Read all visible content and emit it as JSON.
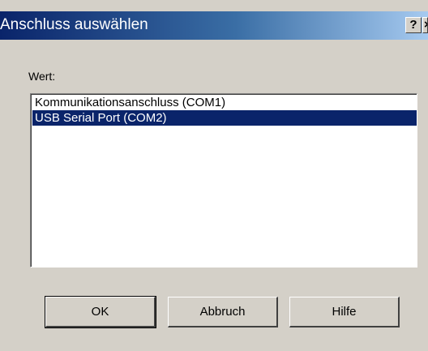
{
  "window": {
    "title": "Anschluss auswählen",
    "help_glyph": "?",
    "close_glyph": "×"
  },
  "content": {
    "value_label": "Wert:",
    "list_items": [
      {
        "label": "Kommunikationsanschluss (COM1)",
        "selected": false
      },
      {
        "label": "USB Serial Port (COM2)",
        "selected": true
      }
    ]
  },
  "buttons": {
    "ok_label": "OK",
    "cancel_label": "Abbruch",
    "help_label": "Hilfe"
  },
  "colors": {
    "titlebar_start": "#0a246a",
    "titlebar_end": "#a6caf0",
    "selection": "#0a246a",
    "face": "#d4d0c8"
  },
  "icons": {
    "help": "question-mark-icon",
    "close": "close-icon"
  }
}
